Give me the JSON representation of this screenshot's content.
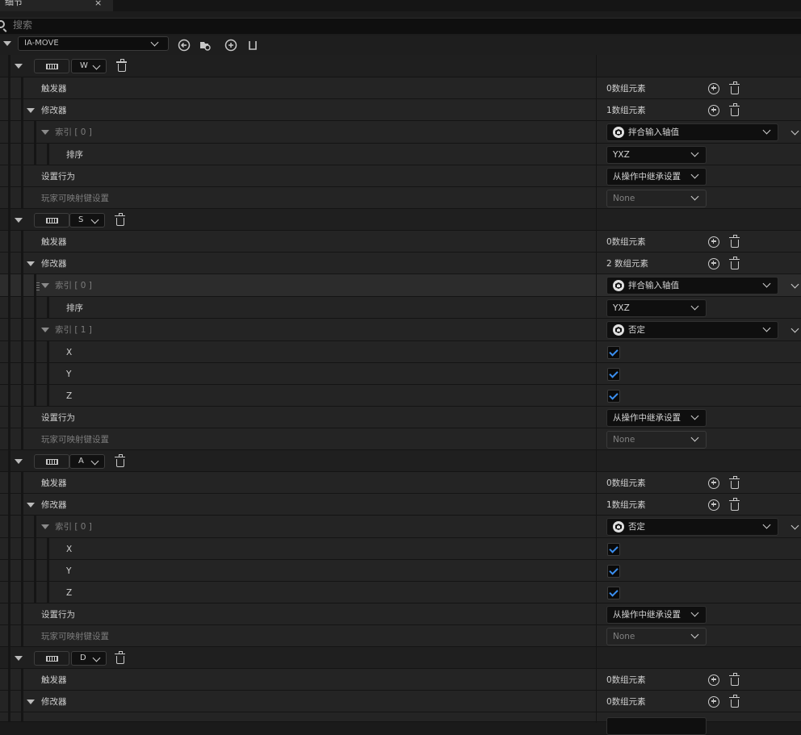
{
  "tab": {
    "title": "细节",
    "close_glyph": "×"
  },
  "search": {
    "placeholder": "搜索"
  },
  "header": {
    "asset_name": "IA-MOVE"
  },
  "labels": {
    "triggers": "触发器",
    "modifiers": "修改器",
    "behavior": "设置行为",
    "player_mapping": "玩家可映射键设置",
    "sort": "排序",
    "x": "X",
    "y": "Y",
    "z": "Z"
  },
  "values": {
    "zero_elements": "0数组元素",
    "one_element": "1数组元素",
    "two_elements": "2 数组元素",
    "inherit": "从操作中继承设置",
    "none": "None",
    "yxz": "YXZ",
    "swizzle": "拌合输入轴值",
    "negate": "否定"
  },
  "mappings": [
    {
      "key": "W",
      "modifiers": [
        {
          "index_label": "索引 [ 0 ]",
          "type": "拌合输入轴值",
          "order": "YXZ"
        }
      ]
    },
    {
      "key": "S",
      "modifiers": [
        {
          "index_label": "索引 [ 0 ]",
          "type": "拌合输入轴值",
          "order": "YXZ"
        },
        {
          "index_label": "索引 [ 1 ]",
          "type": "否定",
          "x": true,
          "y": true,
          "z": true
        }
      ]
    },
    {
      "key": "A",
      "modifiers": [
        {
          "index_label": "索引 [ 0 ]",
          "type": "否定",
          "x": true,
          "y": true,
          "z": true
        }
      ]
    },
    {
      "key": "D",
      "modifiers": []
    }
  ],
  "icons": {
    "keyboard": "keyboard-icon",
    "trash": "trash-icon",
    "add": "add-circle-icon",
    "modifier": "unreal-logo-icon",
    "check": "check-icon"
  },
  "colors": {
    "checkbox_check": "#3b8ff0",
    "background": "#1a1a1a",
    "row": "#242424"
  }
}
